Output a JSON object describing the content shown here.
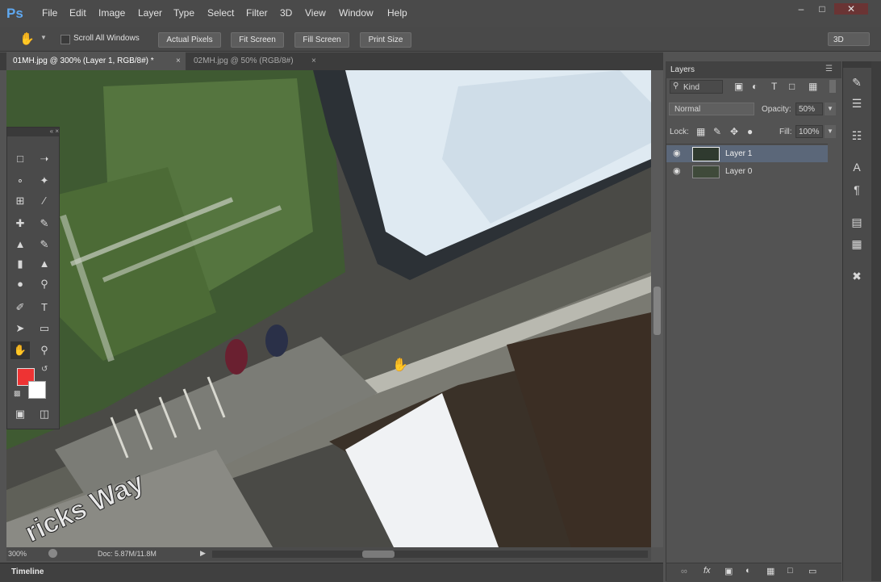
{
  "menubar": {
    "logo": "Ps",
    "items": [
      "File",
      "Edit",
      "Image",
      "Layer",
      "Type",
      "Select",
      "Filter",
      "3D",
      "View",
      "Window",
      "Help"
    ]
  },
  "options": {
    "scroll_all": "Scroll All Windows",
    "buttons": [
      "Actual Pixels",
      "Fit Screen",
      "Fill Screen",
      "Print Size"
    ],
    "mode_3d": "3D"
  },
  "tabs": [
    {
      "label": "01MH.jpg @ 300% (Layer 1, RGB/8#) *",
      "active": true
    },
    {
      "label": "02MH.jpg @ 50% (RGB/8#)",
      "active": false
    }
  ],
  "canvas": {
    "road_text": "ricks Way"
  },
  "status": {
    "zoom": "300%",
    "doc": "Doc: 5.87M/11.8M"
  },
  "timeline": {
    "label": "Timeline"
  },
  "layers_panel": {
    "title": "Layers",
    "kind": "Kind",
    "blend": "Normal",
    "opacity_label": "Opacity:",
    "opacity_value": "50%",
    "lock_label": "Lock:",
    "fill_label": "Fill:",
    "fill_value": "100%",
    "layers": [
      {
        "name": "Layer 1",
        "selected": true
      },
      {
        "name": "Layer 0",
        "selected": false
      }
    ]
  },
  "colors": {
    "foreground": "#ee3333",
    "background": "#ffffff",
    "selection": "#5b6779"
  }
}
